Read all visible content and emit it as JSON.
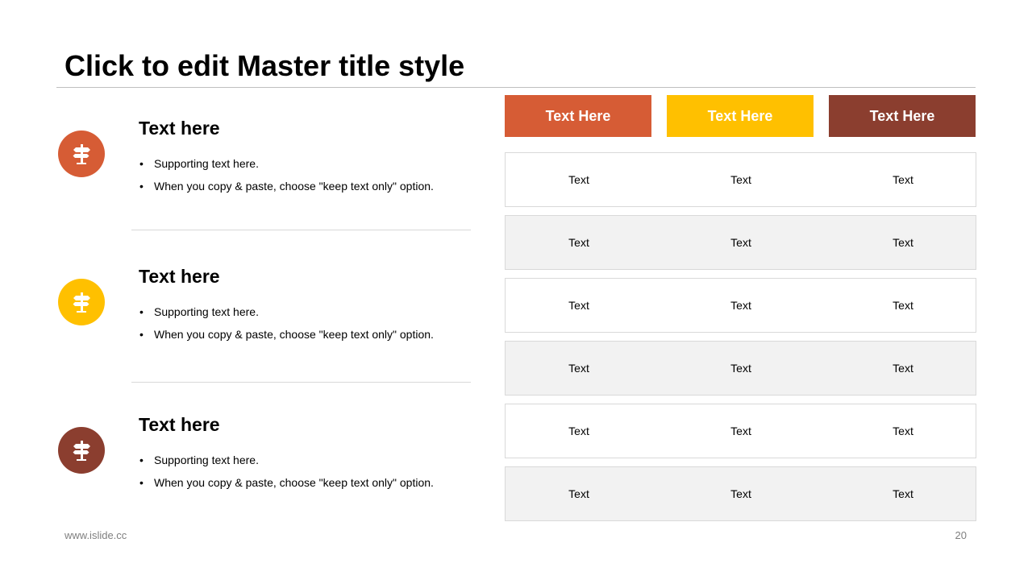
{
  "slide": {
    "title": "Click to edit Master title style",
    "footer": "www.islide.cc",
    "page_number": "20"
  },
  "colors": {
    "orange": "#D65C35",
    "yellow": "#FFC000",
    "brown": "#8B3E2F"
  },
  "items": [
    {
      "icon": "signpost-icon",
      "heading": "Text here",
      "bullets": [
        "Supporting text here.",
        "When you copy & paste, choose \"keep text only\" option."
      ]
    },
    {
      "icon": "signpost-icon",
      "heading": "Text here",
      "bullets": [
        "Supporting text here.",
        "When you copy & paste, choose \"keep text only\" option."
      ]
    },
    {
      "icon": "signpost-icon",
      "heading": "Text here",
      "bullets": [
        "Supporting text here.",
        "When you copy & paste, choose \"keep text only\" option."
      ]
    }
  ],
  "table": {
    "headers": [
      "Text Here",
      "Text Here",
      "Text Here"
    ],
    "rows": [
      [
        "Text",
        "Text",
        "Text"
      ],
      [
        "Text",
        "Text",
        "Text"
      ],
      [
        "Text",
        "Text",
        "Text"
      ],
      [
        "Text",
        "Text",
        "Text"
      ],
      [
        "Text",
        "Text",
        "Text"
      ],
      [
        "Text",
        "Text",
        "Text"
      ]
    ]
  }
}
